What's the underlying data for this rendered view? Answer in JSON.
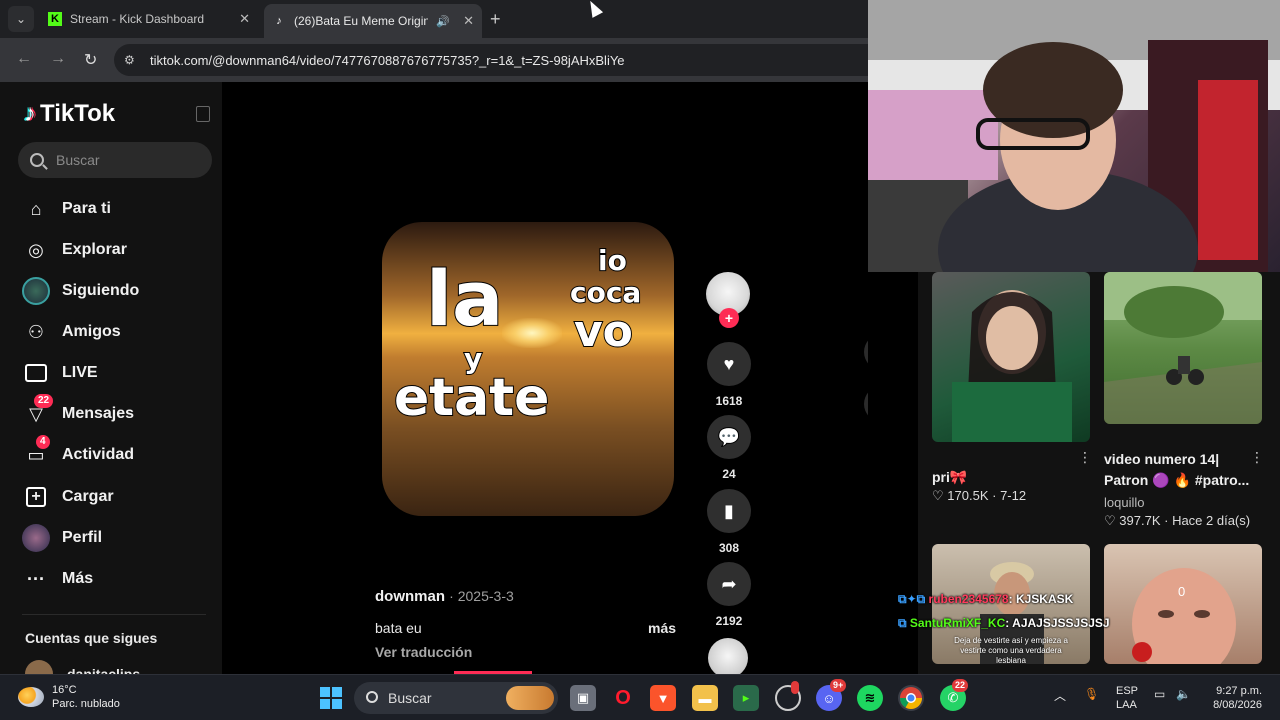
{
  "browser": {
    "tabs": [
      {
        "title": "Stream - Kick Dashboard",
        "active": false
      },
      {
        "title": "(26)Bata Eu Meme Original",
        "active": true
      }
    ],
    "url": "tiktok.com/@downman64/video/7477670887676775735?_r=1&_t=ZS-98jAHxBliYe"
  },
  "tiktok": {
    "logo": "TikTok",
    "search_placeholder": "Buscar",
    "nav": [
      {
        "label": "Para ti",
        "icon": "home-icon"
      },
      {
        "label": "Explorar",
        "icon": "compass-icon"
      },
      {
        "label": "Siguiendo",
        "icon": "following-avatar-icon"
      },
      {
        "label": "Amigos",
        "icon": "friends-icon"
      },
      {
        "label": "LIVE",
        "icon": "live-icon"
      },
      {
        "label": "Mensajes",
        "icon": "messages-icon",
        "badge": "22"
      },
      {
        "label": "Actividad",
        "icon": "activity-icon",
        "badge": "4"
      },
      {
        "label": "Cargar",
        "icon": "upload-icon"
      },
      {
        "label": "Perfil",
        "icon": "profile-avatar-icon"
      },
      {
        "label": "Más",
        "icon": "more-icon"
      }
    ],
    "following_heading": "Cuentas que sigues",
    "following": [
      {
        "name": "danitaclips"
      }
    ],
    "video": {
      "meme_words": [
        "la",
        "y",
        "etate",
        "io",
        "coca",
        "vo"
      ],
      "author": "downman",
      "date": "· 2025-3-3",
      "description": "bata eu",
      "more": "más",
      "translate": "Ver traducción",
      "likes": "1618",
      "comments": "24",
      "saves": "308",
      "shares": "2192",
      "progress": 0.12
    }
  },
  "recommendations": [
    {
      "title": "pri🎀",
      "likes": "170.5K",
      "date": "7-12"
    },
    {
      "title": "video numero 14| Patron 🟣 🔥 #patro...",
      "author": "loquillo",
      "likes": "397.7K",
      "date": "Hace 2 día(s)"
    }
  ],
  "thumb_overlay": {
    "counter": "0",
    "caption": "Deja de vestirte así y empieza a vestirte como una verdadera lesbiana"
  },
  "chat": [
    {
      "user": "ruben2345678",
      "message": "KJSKASK",
      "color": "#ff3b5c"
    },
    {
      "user": "SantuRmiXF_KC",
      "message": "AJAJSJSSJSJSJ",
      "color": "#53fc18"
    }
  ],
  "taskbar": {
    "weather_temp": "16°C",
    "weather_desc": "Parc. nublado",
    "search_placeholder": "Buscar",
    "lang_top": "ESP",
    "lang_bottom": "LAA",
    "time": "9:27 p.m.",
    "date": "8/08/2026",
    "badges": {
      "discord": "9+",
      "whatsapp": "22"
    }
  }
}
